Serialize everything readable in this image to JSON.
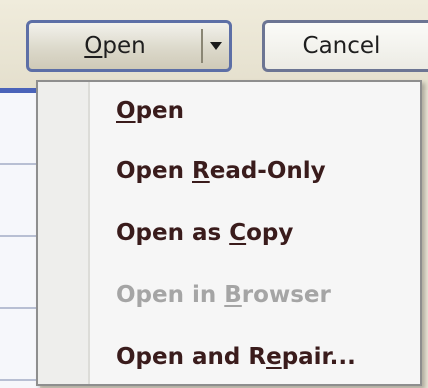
{
  "buttons": {
    "open": {
      "pre": "",
      "key": "O",
      "post": "pen"
    },
    "cancel": "Cancel"
  },
  "menu": {
    "items": [
      {
        "pre": "",
        "key": "O",
        "post": "pen",
        "enabled": true
      },
      {
        "pre": "Open ",
        "key": "R",
        "post": "ead-Only",
        "enabled": true
      },
      {
        "pre": "Open as ",
        "key": "C",
        "post": "opy",
        "enabled": true
      },
      {
        "pre": "Open in ",
        "key": "B",
        "post": "rowser",
        "enabled": false
      },
      {
        "pre": "Open and R",
        "key": "e",
        "post": "pair...",
        "enabled": true
      }
    ]
  },
  "colors": {
    "menu_text": "#3a1c1c",
    "disabled_text": "#a5a5a5",
    "button_border": "#5d6fa6"
  }
}
